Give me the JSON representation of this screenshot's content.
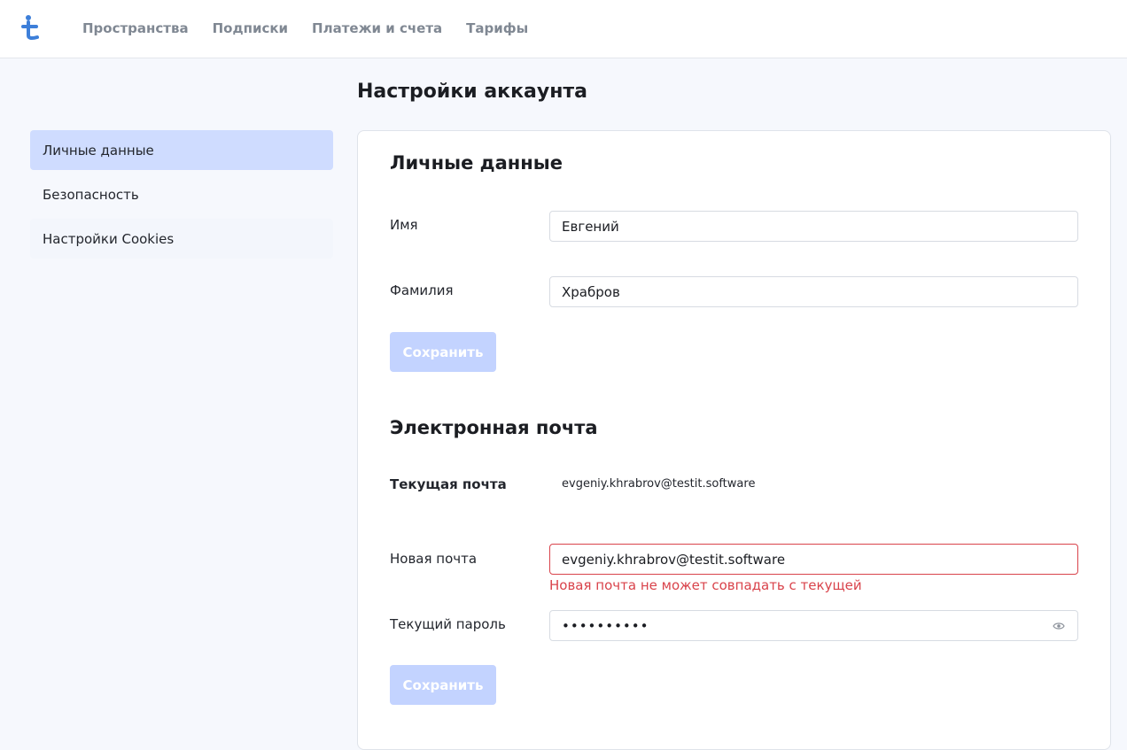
{
  "header": {
    "logo_icon": "testit-logo-icon",
    "nav": [
      "Пространства",
      "Подписки",
      "Платежи и счета",
      "Тарифы"
    ]
  },
  "sidebar": {
    "items": [
      {
        "label": "Личные данные",
        "active": true
      },
      {
        "label": "Безопасность",
        "active": false
      },
      {
        "label": "Настройки Cookies",
        "active": false
      }
    ]
  },
  "page": {
    "title": "Настройки аккаунта"
  },
  "personal": {
    "title": "Личные данные",
    "first_name_label": "Имя",
    "first_name_value": "Евгений",
    "last_name_label": "Фамилия",
    "last_name_value": "Храбров",
    "save_label": "Сохранить"
  },
  "email": {
    "title": "Электронная почта",
    "current_label": "Текущая почта",
    "current_value": "evgeniy.khrabrov@testit.software",
    "new_label": "Новая почта",
    "new_value": "evgeniy.khrabrov@testit.software",
    "new_error": "Новая почта не может совпадать с текущей",
    "password_label": "Текущий пароль",
    "password_value": "••••••••••",
    "save_label": "Сохранить"
  },
  "colors": {
    "accent": "#3d7fd9",
    "active_bg": "#cfdcff",
    "button_disabled": "#c3d3ff",
    "error": "#d9434b"
  }
}
